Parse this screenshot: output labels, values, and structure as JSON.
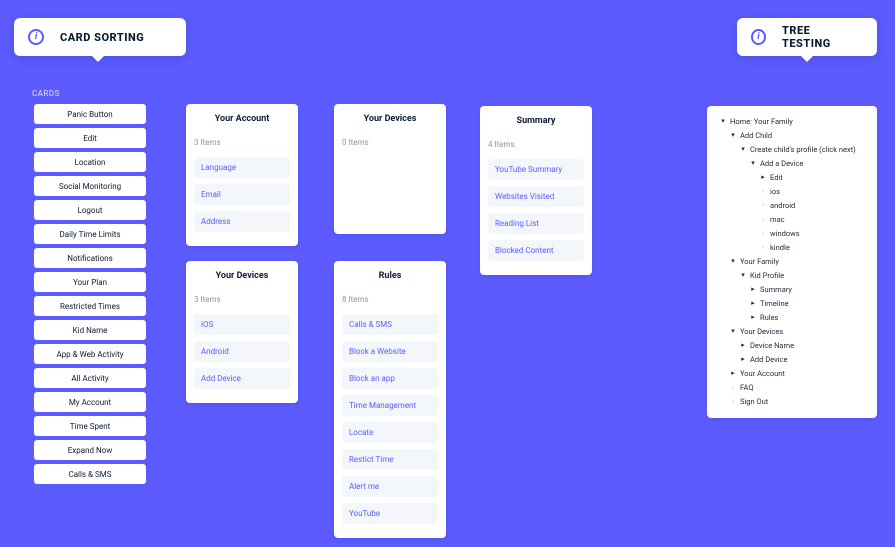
{
  "tabs": {
    "left": "CARD SORTING",
    "right": "TREE TESTING"
  },
  "cards_heading": "CARDS",
  "cards": [
    "Panic Button",
    "Edit",
    "Location",
    "Social Monitoring",
    "Logout",
    "Daily Time Limits",
    "Notifications",
    "Your Plan",
    "Restricted Times",
    "Kid Name",
    "App & Web Activity",
    "All Activity",
    "My Account",
    "Time Spent",
    "Expand Now",
    "Calls & SMS"
  ],
  "columns": {
    "a": {
      "title": "Your Account",
      "count": "3 Items",
      "items": [
        "Language",
        "Email",
        "Address"
      ]
    },
    "b": {
      "title": "Your Devices",
      "count": "3 Items",
      "items": [
        "iOS",
        "Android",
        "Add Device"
      ]
    },
    "c": {
      "title": "Your Devices",
      "count": "0 Items",
      "items": []
    },
    "d": {
      "title": "Rules",
      "count": "8 Items",
      "items": [
        "Calls & SMS",
        "Block a Website",
        "Block an app",
        "Time Management",
        "Locate",
        "Restict Time",
        "Alert me",
        "YouTube"
      ]
    },
    "e": {
      "title": "Summary",
      "count": "4 Items",
      "items": [
        "YouTube Summary",
        "Websites Visited",
        "Reading List",
        "Blocked Content"
      ]
    }
  },
  "tree": [
    {
      "depth": 0,
      "state": "open",
      "label": "Home: Your Family"
    },
    {
      "depth": 1,
      "state": "open",
      "label": "Add Child"
    },
    {
      "depth": 2,
      "state": "open",
      "label": "Create child's profile (click next)"
    },
    {
      "depth": 3,
      "state": "open",
      "label": "Add a Device"
    },
    {
      "depth": 4,
      "state": "closed",
      "label": "Edit"
    },
    {
      "depth": 4,
      "state": "leaf",
      "label": "ios"
    },
    {
      "depth": 4,
      "state": "leaf",
      "label": "android"
    },
    {
      "depth": 4,
      "state": "leaf",
      "label": "mac"
    },
    {
      "depth": 4,
      "state": "leaf",
      "label": "windows"
    },
    {
      "depth": 4,
      "state": "leaf",
      "label": "kindle"
    },
    {
      "depth": 1,
      "state": "open",
      "label": "Your Family"
    },
    {
      "depth": 2,
      "state": "open",
      "label": "Kid Profile"
    },
    {
      "depth": 3,
      "state": "closed",
      "label": "Summary"
    },
    {
      "depth": 3,
      "state": "closed",
      "label": "Timeline"
    },
    {
      "depth": 3,
      "state": "closed",
      "label": "Rules"
    },
    {
      "depth": 1,
      "state": "open",
      "label": "Your Devices"
    },
    {
      "depth": 2,
      "state": "closed",
      "label": "Device Name"
    },
    {
      "depth": 2,
      "state": "closed",
      "label": "Add Device"
    },
    {
      "depth": 1,
      "state": "closed",
      "label": "Your Account"
    },
    {
      "depth": 1,
      "state": "leaf",
      "label": "FAQ"
    },
    {
      "depth": 1,
      "state": "leaf",
      "label": "Sign Out"
    }
  ]
}
